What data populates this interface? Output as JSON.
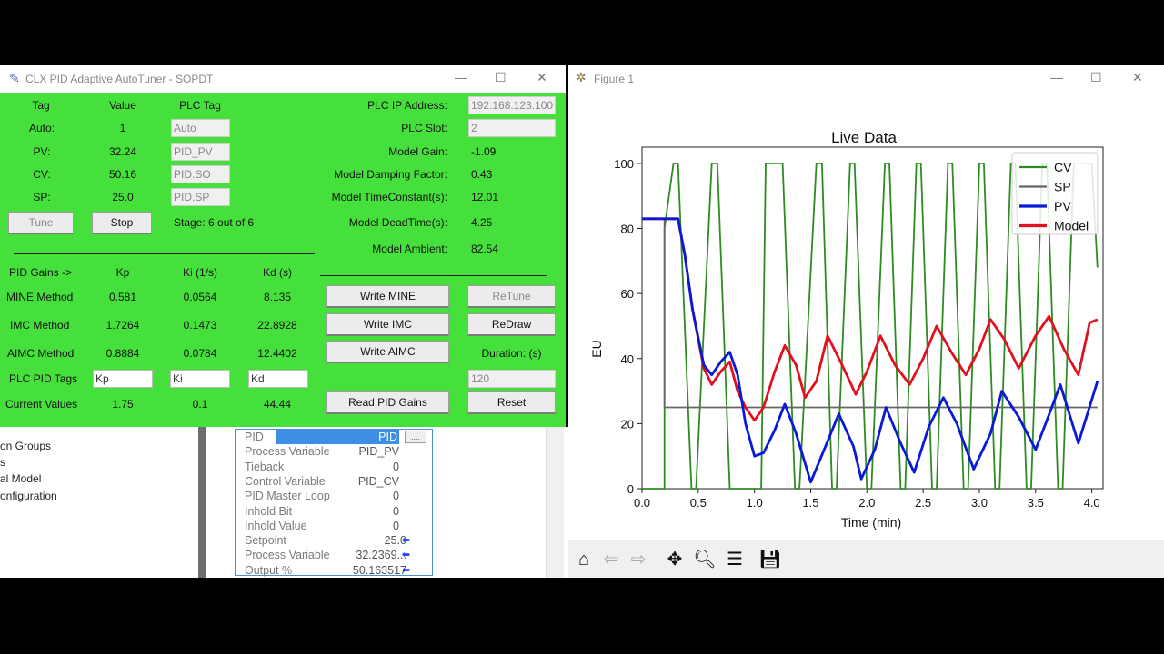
{
  "app_window": {
    "title": "CLX PID Adaptive AutoTuner - SOPDT",
    "header": {
      "tag": "Tag",
      "value": "Value",
      "plc_tag": "PLC Tag"
    },
    "rows": [
      {
        "label": "Auto:",
        "value": "1",
        "plc_tag": "Auto"
      },
      {
        "label": "PV:",
        "value": "32.24",
        "plc_tag": "PID_PV"
      },
      {
        "label": "CV:",
        "value": "50.16",
        "plc_tag": "PID.SO"
      },
      {
        "label": "SP:",
        "value": "25.0",
        "plc_tag": "PID.SP"
      }
    ],
    "tune_label": "Tune",
    "stop_label": "Stop",
    "stage_text": "Stage: 6 out of 6",
    "plc": {
      "ip_label": "PLC IP Address:",
      "ip_value": "192.168.123.100",
      "slot_label": "PLC Slot:",
      "slot_value": "2"
    },
    "model": [
      {
        "label": "Model Gain:",
        "value": "-1.09"
      },
      {
        "label": "Model Damping Factor:",
        "value": "0.43"
      },
      {
        "label": "Model TimeConstant(s):",
        "value": "12.01"
      },
      {
        "label": "Model DeadTime(s):",
        "value": "4.25"
      },
      {
        "label": "Model Ambient:",
        "value": "82.54"
      }
    ],
    "gains_header": {
      "label": "PID Gains ->",
      "kp": "Kp",
      "ki": "Ki (1/s)",
      "kd": "Kd (s)"
    },
    "methods": [
      {
        "name": "MINE Method",
        "kp": "0.581",
        "ki": "0.0564",
        "kd": "8.135",
        "write": "Write MINE"
      },
      {
        "name": "IMC Method",
        "kp": "1.7264",
        "ki": "0.1473",
        "kd": "22.8928",
        "write": "Write IMC"
      },
      {
        "name": "AIMC Method",
        "kp": "0.8884",
        "ki": "0.0784",
        "kd": "12.4402",
        "write": "Write AIMC"
      }
    ],
    "retune_label": "ReTune",
    "redraw_label": "ReDraw",
    "duration_label": "Duration: (s)",
    "duration_value": "120",
    "plc_pid_tags": {
      "label": "PLC PID Tags",
      "kp": "Kp",
      "ki": "Ki",
      "kd": "Kd"
    },
    "current": {
      "label": "Current Values",
      "kp": "1.75",
      "ki": "0.1",
      "kd": "44.44"
    },
    "read_label": "Read PID Gains",
    "reset_label": "Reset"
  },
  "background_app": {
    "tree_items": [
      "on Groups",
      "s",
      "al Model",
      "onfiguration"
    ],
    "props": [
      {
        "name": "PID",
        "value": "PID"
      },
      {
        "name": "Process Variable",
        "value": "PID_PV"
      },
      {
        "name": "Tieback",
        "value": "0"
      },
      {
        "name": "Control Variable",
        "value": "PID_CV"
      },
      {
        "name": "PID Master Loop",
        "value": "0"
      },
      {
        "name": "Inhold Bit",
        "value": "0"
      },
      {
        "name": "Inhold Value",
        "value": "0"
      },
      {
        "name": "Setpoint",
        "value": "25.0"
      },
      {
        "name": "Process Variable",
        "value": "32.2369..."
      },
      {
        "name": "Output %",
        "value": "50.163517"
      }
    ],
    "pid_btn": "...."
  },
  "figure_window": {
    "title": "Figure 1"
  },
  "colors": {
    "cv": "#2e8b22",
    "sp": "#666666",
    "pv": "#0a18d8",
    "model": "#e0101e",
    "app_bg": "#46e03c"
  },
  "chart_data": {
    "type": "line",
    "title": "Live Data",
    "xlabel": "Time (min)",
    "ylabel": "EU",
    "xlim": [
      0.0,
      4.1
    ],
    "ylim": [
      0,
      105
    ],
    "xticks": [
      0.0,
      0.5,
      1.0,
      1.5,
      2.0,
      2.5,
      3.0,
      3.5,
      4.0
    ],
    "yticks": [
      0,
      20,
      40,
      60,
      80,
      100
    ],
    "legend_position": "top-right",
    "series": [
      {
        "name": "CV",
        "color": "#2e8b22",
        "width": 1.8,
        "x": [
          0.0,
          0.2,
          0.2,
          0.28,
          0.32,
          0.44,
          0.48,
          0.62,
          0.67,
          0.78,
          0.82,
          1.06,
          1.1,
          1.2,
          1.25,
          1.36,
          1.4,
          1.55,
          1.6,
          1.69,
          1.73,
          1.85,
          1.89,
          2.0,
          2.04,
          2.16,
          2.2,
          2.3,
          2.34,
          2.44,
          2.48,
          2.58,
          2.62,
          2.72,
          2.76,
          2.86,
          2.9,
          3.0,
          3.04,
          3.14,
          3.18,
          3.28,
          3.32,
          3.42,
          3.46,
          3.56,
          3.6,
          3.7,
          3.74,
          3.84,
          3.88,
          4.0,
          4.05
        ],
        "y": [
          0,
          0,
          80,
          100,
          100,
          0,
          0,
          100,
          100,
          0,
          0,
          0,
          100,
          100,
          100,
          0,
          0,
          100,
          100,
          0,
          0,
          100,
          100,
          0,
          0,
          100,
          100,
          0,
          0,
          100,
          100,
          0,
          0,
          100,
          100,
          0,
          0,
          100,
          100,
          0,
          0,
          100,
          100,
          0,
          0,
          100,
          100,
          0,
          0,
          100,
          100,
          100,
          68
        ]
      },
      {
        "name": "SP",
        "color": "#666666",
        "width": 1.8,
        "x": [
          0.0,
          0.19,
          0.2,
          0.2,
          4.05
        ],
        "y": [
          83,
          83,
          83,
          25,
          25
        ]
      },
      {
        "name": "PV",
        "color": "#0a18d8",
        "width": 2.8,
        "x": [
          0.0,
          0.32,
          0.38,
          0.45,
          0.55,
          0.62,
          0.7,
          0.78,
          0.85,
          0.92,
          1.0,
          1.08,
          1.18,
          1.27,
          1.37,
          1.5,
          1.62,
          1.75,
          1.88,
          1.95,
          2.07,
          2.17,
          2.3,
          2.42,
          2.55,
          2.68,
          2.8,
          2.95,
          3.1,
          3.2,
          3.35,
          3.5,
          3.6,
          3.72,
          3.88,
          4.05
        ],
        "y": [
          83,
          83,
          72,
          55,
          38,
          35,
          39,
          42,
          35,
          20,
          10,
          11,
          18,
          26,
          17,
          2,
          12,
          23,
          13,
          3,
          12,
          25,
          14,
          5,
          19,
          28,
          20,
          6,
          17,
          30,
          22,
          12,
          21,
          32,
          14,
          33
        ]
      },
      {
        "name": "Model",
        "color": "#e0101e",
        "width": 2.8,
        "x": [
          0.0,
          0.32,
          0.38,
          0.45,
          0.55,
          0.62,
          0.7,
          0.78,
          0.85,
          0.92,
          1.0,
          1.08,
          1.18,
          1.27,
          1.37,
          1.45,
          1.55,
          1.65,
          1.78,
          1.9,
          2.0,
          2.12,
          2.25,
          2.38,
          2.5,
          2.62,
          2.75,
          2.88,
          3.0,
          3.1,
          3.22,
          3.35,
          3.5,
          3.62,
          3.75,
          3.88,
          3.98,
          4.05
        ],
        "y": [
          83,
          83,
          72,
          55,
          37,
          32,
          36,
          39,
          30,
          25,
          21,
          25,
          36,
          44,
          38,
          28,
          33,
          47,
          38,
          29,
          36,
          47,
          38,
          32,
          40,
          50,
          42,
          35,
          43,
          52,
          46,
          37,
          47,
          53,
          43,
          35,
          51,
          52
        ]
      }
    ]
  }
}
